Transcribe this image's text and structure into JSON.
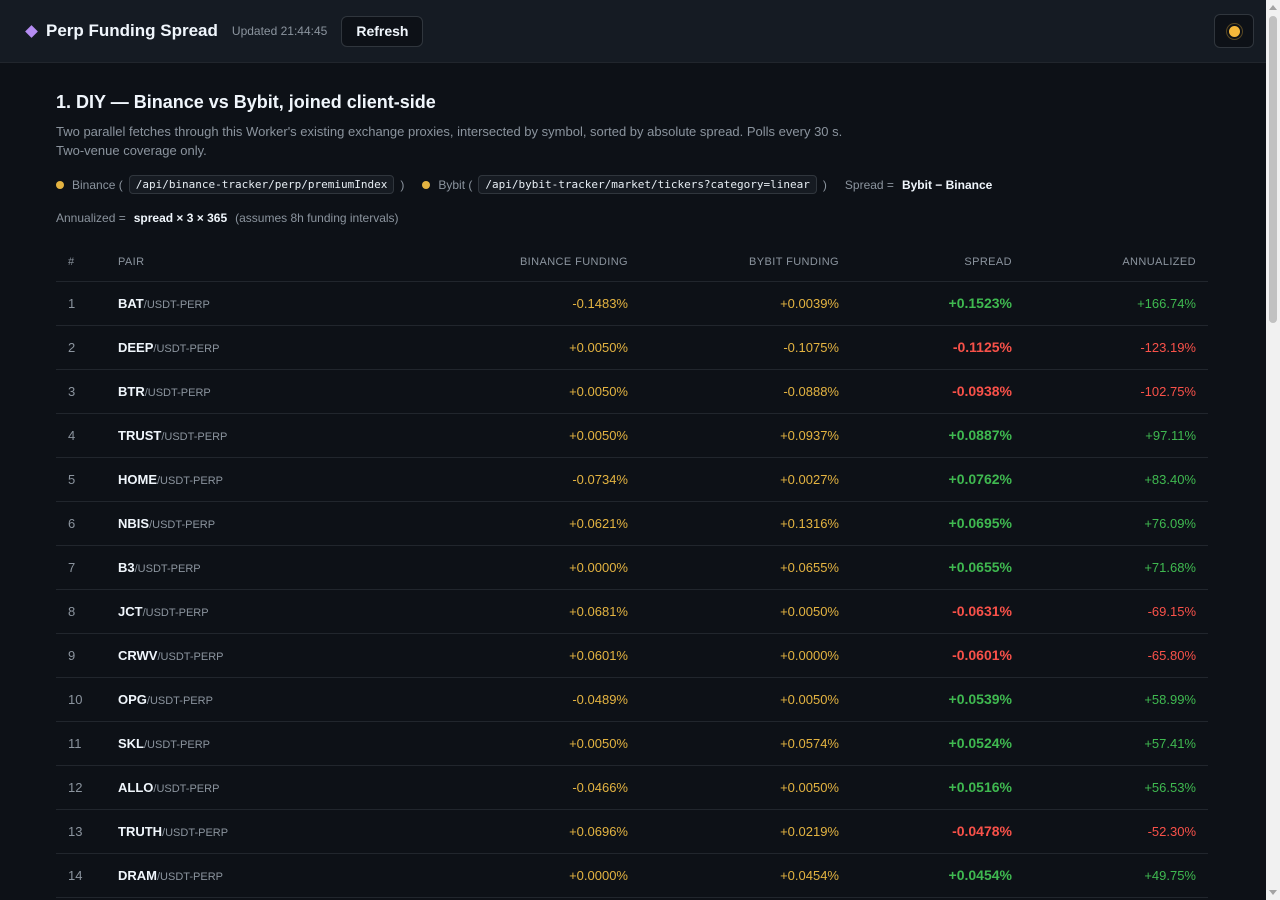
{
  "header": {
    "title": "Perp Funding Spread",
    "updated": "Updated 21:44:45",
    "refresh_label": "Refresh",
    "theme_icon": "sun-icon"
  },
  "section": {
    "title": "1. DIY — Binance vs Bybit, joined client-side",
    "desc_line1": "Two parallel fetches through this Worker's existing exchange proxies, intersected by symbol, sorted by absolute spread. Polls every 30 s.",
    "desc_line2": "Two-venue coverage only.",
    "binance_label": "Binance (",
    "binance_path": "/api/binance-tracker/perp/premiumIndex",
    "bybit_label": "Bybit (",
    "bybit_path": "/api/bybit-tracker/market/tickers?category=linear",
    "close_paren": ")",
    "spread_label": "Spread =",
    "spread_formula": "Bybit − Binance",
    "annualized_label": "Annualized =",
    "annualized_formula": "spread × 3 × 365",
    "annualized_note": "(assumes 8h funding intervals)"
  },
  "colors": {
    "positive": "#3fb950",
    "negative": "#f85149",
    "funding": "#e3b341",
    "accent": "#b58cf2"
  },
  "table": {
    "headers": [
      "#",
      "PAIR",
      "BINANCE FUNDING",
      "BYBIT FUNDING",
      "SPREAD",
      "ANNUALIZED"
    ],
    "rows": [
      {
        "idx": "1",
        "sym": "BAT",
        "quote": "/USDT-PERP",
        "binance": "-0.1483%",
        "bybit": "+0.0039%",
        "spread": "+0.1523%",
        "annual": "+166.74%",
        "sign": "pos"
      },
      {
        "idx": "2",
        "sym": "DEEP",
        "quote": "/USDT-PERP",
        "binance": "+0.0050%",
        "bybit": "-0.1075%",
        "spread": "-0.1125%",
        "annual": "-123.19%",
        "sign": "neg"
      },
      {
        "idx": "3",
        "sym": "BTR",
        "quote": "/USDT-PERP",
        "binance": "+0.0050%",
        "bybit": "-0.0888%",
        "spread": "-0.0938%",
        "annual": "-102.75%",
        "sign": "neg"
      },
      {
        "idx": "4",
        "sym": "TRUST",
        "quote": "/USDT-PERP",
        "binance": "+0.0050%",
        "bybit": "+0.0937%",
        "spread": "+0.0887%",
        "annual": "+97.11%",
        "sign": "pos"
      },
      {
        "idx": "5",
        "sym": "HOME",
        "quote": "/USDT-PERP",
        "binance": "-0.0734%",
        "bybit": "+0.0027%",
        "spread": "+0.0762%",
        "annual": "+83.40%",
        "sign": "pos"
      },
      {
        "idx": "6",
        "sym": "NBIS",
        "quote": "/USDT-PERP",
        "binance": "+0.0621%",
        "bybit": "+0.1316%",
        "spread": "+0.0695%",
        "annual": "+76.09%",
        "sign": "pos"
      },
      {
        "idx": "7",
        "sym": "B3",
        "quote": "/USDT-PERP",
        "binance": "+0.0000%",
        "bybit": "+0.0655%",
        "spread": "+0.0655%",
        "annual": "+71.68%",
        "sign": "pos"
      },
      {
        "idx": "8",
        "sym": "JCT",
        "quote": "/USDT-PERP",
        "binance": "+0.0681%",
        "bybit": "+0.0050%",
        "spread": "-0.0631%",
        "annual": "-69.15%",
        "sign": "neg"
      },
      {
        "idx": "9",
        "sym": "CRWV",
        "quote": "/USDT-PERP",
        "binance": "+0.0601%",
        "bybit": "+0.0000%",
        "spread": "-0.0601%",
        "annual": "-65.80%",
        "sign": "neg"
      },
      {
        "idx": "10",
        "sym": "OPG",
        "quote": "/USDT-PERP",
        "binance": "-0.0489%",
        "bybit": "+0.0050%",
        "spread": "+0.0539%",
        "annual": "+58.99%",
        "sign": "pos"
      },
      {
        "idx": "11",
        "sym": "SKL",
        "quote": "/USDT-PERP",
        "binance": "+0.0050%",
        "bybit": "+0.0574%",
        "spread": "+0.0524%",
        "annual": "+57.41%",
        "sign": "pos"
      },
      {
        "idx": "12",
        "sym": "ALLO",
        "quote": "/USDT-PERP",
        "binance": "-0.0466%",
        "bybit": "+0.0050%",
        "spread": "+0.0516%",
        "annual": "+56.53%",
        "sign": "pos"
      },
      {
        "idx": "13",
        "sym": "TRUTH",
        "quote": "/USDT-PERP",
        "binance": "+0.0696%",
        "bybit": "+0.0219%",
        "spread": "-0.0478%",
        "annual": "-52.30%",
        "sign": "neg"
      },
      {
        "idx": "14",
        "sym": "DRAM",
        "quote": "/USDT-PERP",
        "binance": "+0.0000%",
        "bybit": "+0.0454%",
        "spread": "+0.0454%",
        "annual": "+49.75%",
        "sign": "pos"
      }
    ]
  }
}
